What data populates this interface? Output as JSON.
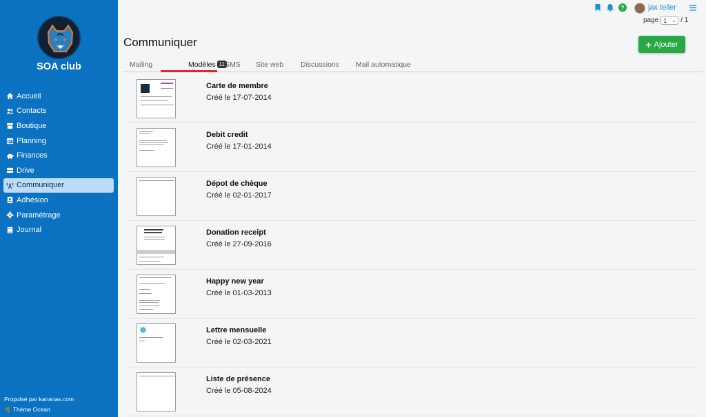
{
  "sidebar": {
    "club_name": "SOA club",
    "items": [
      {
        "label": "Accueil",
        "icon": "home-icon"
      },
      {
        "label": "Contacts",
        "icon": "users-icon"
      },
      {
        "label": "Boutique",
        "icon": "store-icon"
      },
      {
        "label": "Planning",
        "icon": "calendar-icon"
      },
      {
        "label": "Finances",
        "icon": "piggy-bank-icon"
      },
      {
        "label": "Drive",
        "icon": "drive-icon"
      },
      {
        "label": "Communiquer",
        "icon": "broadcast-icon",
        "active": true
      },
      {
        "label": "Adhésion",
        "icon": "id-card-icon"
      },
      {
        "label": "Paramétrage",
        "icon": "gear-icon"
      },
      {
        "label": "Journal",
        "icon": "book-icon"
      }
    ],
    "footer_powered": "Propulsé par kananas.com",
    "footer_theme": "Thème Ocean"
  },
  "topbar": {
    "user_name": "jax teller",
    "page_label": "page",
    "page_current": "1",
    "page_total": "/ 1"
  },
  "main": {
    "title": "Communiquer",
    "add_label": "Ajouter",
    "tabs": [
      {
        "label": "Mailing"
      },
      {
        "label": "Modèles",
        "badge": "11",
        "active": true
      },
      {
        "label": "SMS"
      },
      {
        "label": "Site web"
      },
      {
        "label": "Discussions"
      },
      {
        "label": "Mail automatique"
      }
    ],
    "templates": [
      {
        "title": "Carte de membre",
        "date": "Créé le 17-07-2014"
      },
      {
        "title": "Debit credit",
        "date": "Créé le 17-01-2014"
      },
      {
        "title": "Dépot de chèque",
        "date": "Créé le 02-01-2017"
      },
      {
        "title": "Donation receipt",
        "date": "Créé le 27-09-2016"
      },
      {
        "title": "Happy new year",
        "date": "Créé le 01-03-2013"
      },
      {
        "title": "Lettre mensuelle",
        "date": "Créé le 02-03-2021"
      },
      {
        "title": "Liste de présence",
        "date": "Créé le 05-08-2024"
      }
    ]
  },
  "colors": {
    "sidebar_bg": "#0b72c1",
    "active_nav_bg": "#bcdbf7",
    "add_button": "#28a745",
    "active_tab_underline": "#d9262f",
    "link": "#1f8fce"
  }
}
